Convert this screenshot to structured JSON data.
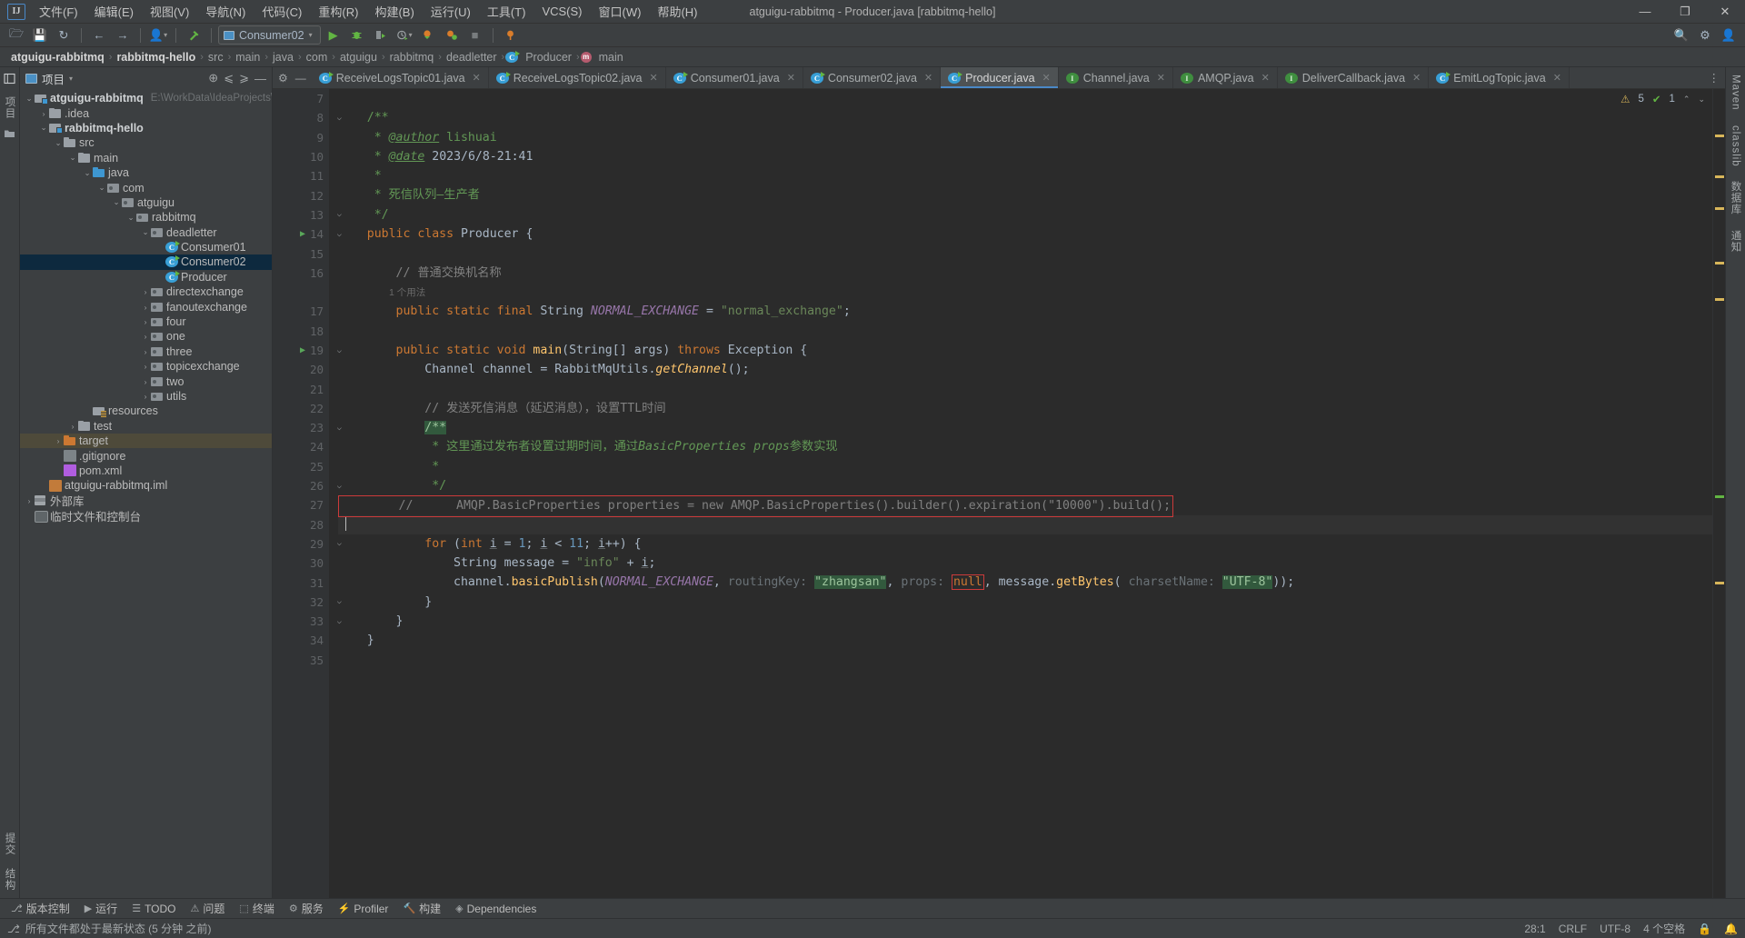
{
  "window": {
    "title": "atguigu-rabbitmq - Producer.java [rabbitmq-hello]",
    "logo": "IJ",
    "minimize": "—",
    "maximize": "❐",
    "close": "✕"
  },
  "menubar": {
    "items": [
      {
        "label": "文件(F)",
        "name": "menu-file"
      },
      {
        "label": "编辑(E)",
        "name": "menu-edit"
      },
      {
        "label": "视图(V)",
        "name": "menu-view"
      },
      {
        "label": "导航(N)",
        "name": "menu-navigate"
      },
      {
        "label": "代码(C)",
        "name": "menu-code"
      },
      {
        "label": "重构(R)",
        "name": "menu-refactor"
      },
      {
        "label": "构建(B)",
        "name": "menu-build"
      },
      {
        "label": "运行(U)",
        "name": "menu-run"
      },
      {
        "label": "工具(T)",
        "name": "menu-tools"
      },
      {
        "label": "VCS(S)",
        "name": "menu-vcs"
      },
      {
        "label": "窗口(W)",
        "name": "menu-window"
      },
      {
        "label": "帮助(H)",
        "name": "menu-help"
      }
    ]
  },
  "toolbar": {
    "open_icon": "🗁",
    "save_icon": "💾",
    "sync_icon": "↻",
    "back_icon": "←",
    "forward_icon": "→",
    "profile_icon": "👤",
    "build_icon": "🔨",
    "run_config": "Consumer02",
    "run_icon": "▶",
    "debug_icon": "🐞",
    "run_coverage_icon": "▷",
    "profiler_icon": "⏱",
    "stop_icon": "■",
    "search_icon": "🔍",
    "settings_icon": "⚙",
    "account_icon": "👤"
  },
  "breadcrumb": {
    "items": [
      {
        "label": "atguigu-rabbitmq",
        "bold": true
      },
      {
        "label": "rabbitmq-hello",
        "bold": true
      },
      {
        "label": "src",
        "bold": false
      },
      {
        "label": "main",
        "bold": false
      },
      {
        "label": "java",
        "bold": false
      },
      {
        "label": "com",
        "bold": false
      },
      {
        "label": "atguigu",
        "bold": false
      },
      {
        "label": "rabbitmq",
        "bold": false
      },
      {
        "label": "deadletter",
        "bold": false
      },
      {
        "label": "Producer",
        "bold": false,
        "icon": "class"
      },
      {
        "label": "main",
        "bold": false,
        "icon": "method"
      }
    ],
    "separator": "›"
  },
  "left_rail": {
    "structure_icon": "☰",
    "project_label": "项目",
    "bookmarks_icon": "🗀",
    "bottom": [
      {
        "label": "提交",
        "name": "rail-commit"
      },
      {
        "label": "结构",
        "name": "rail-structure"
      }
    ]
  },
  "project_panel": {
    "title": "项目",
    "dropdown_caret": "▾",
    "locate_icon": "⊕",
    "expand_icon": "⩽",
    "collapse_icon": "⩾",
    "hide_icon": "—",
    "tree": [
      {
        "depth": 0,
        "arrow": "⌄",
        "icon": "mod",
        "label": "atguigu-rabbitmq",
        "bold": true,
        "path": "E:\\WorkData\\IdeaProjects\\Ra",
        "name": "tree-item-atguigu-rabbitmq"
      },
      {
        "depth": 1,
        "arrow": "›",
        "icon": "folder",
        "label": ".idea",
        "name": "tree-item-idea"
      },
      {
        "depth": 1,
        "arrow": "⌄",
        "icon": "mod",
        "label": "rabbitmq-hello",
        "bold": true,
        "name": "tree-item-rabbitmq-hello"
      },
      {
        "depth": 2,
        "arrow": "⌄",
        "icon": "folder",
        "label": "src",
        "name": "tree-item-src"
      },
      {
        "depth": 3,
        "arrow": "⌄",
        "icon": "folder",
        "label": "main",
        "name": "tree-item-main"
      },
      {
        "depth": 4,
        "arrow": "⌄",
        "icon": "folder-blue",
        "label": "java",
        "name": "tree-item-java"
      },
      {
        "depth": 5,
        "arrow": "⌄",
        "icon": "pkg",
        "label": "com",
        "name": "tree-item-com"
      },
      {
        "depth": 6,
        "arrow": "⌄",
        "icon": "pkg",
        "label": "atguigu",
        "name": "tree-item-atguigu"
      },
      {
        "depth": 7,
        "arrow": "⌄",
        "icon": "pkg",
        "label": "rabbitmq",
        "name": "tree-item-rabbitmq"
      },
      {
        "depth": 8,
        "arrow": "⌄",
        "icon": "pkg",
        "label": "deadletter",
        "name": "tree-item-deadletter"
      },
      {
        "depth": 9,
        "arrow": "",
        "icon": "cls",
        "label": "Consumer01",
        "name": "tree-item-consumer01"
      },
      {
        "depth": 9,
        "arrow": "",
        "icon": "cls",
        "label": "Consumer02",
        "selected": true,
        "name": "tree-item-consumer02"
      },
      {
        "depth": 9,
        "arrow": "",
        "icon": "cls",
        "label": "Producer",
        "name": "tree-item-producer"
      },
      {
        "depth": 8,
        "arrow": "›",
        "icon": "pkg",
        "label": "directexchange",
        "name": "tree-item-directexchange"
      },
      {
        "depth": 8,
        "arrow": "›",
        "icon": "pkg",
        "label": "fanoutexchange",
        "name": "tree-item-fanoutexchange"
      },
      {
        "depth": 8,
        "arrow": "›",
        "icon": "pkg",
        "label": "four",
        "name": "tree-item-four"
      },
      {
        "depth": 8,
        "arrow": "›",
        "icon": "pkg",
        "label": "one",
        "name": "tree-item-one"
      },
      {
        "depth": 8,
        "arrow": "›",
        "icon": "pkg",
        "label": "three",
        "name": "tree-item-three"
      },
      {
        "depth": 8,
        "arrow": "›",
        "icon": "pkg",
        "label": "topicexchange",
        "name": "tree-item-topicexchange"
      },
      {
        "depth": 8,
        "arrow": "›",
        "icon": "pkg",
        "label": "two",
        "name": "tree-item-two"
      },
      {
        "depth": 8,
        "arrow": "›",
        "icon": "pkg",
        "label": "utils",
        "name": "tree-item-utils"
      },
      {
        "depth": 4,
        "arrow": "",
        "icon": "res",
        "label": "resources",
        "name": "tree-item-resources"
      },
      {
        "depth": 3,
        "arrow": "›",
        "icon": "folder",
        "label": "test",
        "name": "tree-item-test"
      },
      {
        "depth": 2,
        "arrow": "›",
        "icon": "folder-orange",
        "label": "target",
        "highlight": true,
        "name": "tree-item-target"
      },
      {
        "depth": 2,
        "arrow": "",
        "icon": "file-g",
        "label": ".gitignore",
        "name": "tree-item-gitignore"
      },
      {
        "depth": 2,
        "arrow": "",
        "icon": "file-m",
        "label": "pom.xml",
        "name": "tree-item-pom-xml"
      },
      {
        "depth": 1,
        "arrow": "",
        "icon": "file-iml",
        "label": "atguigu-rabbitmq.iml",
        "name": "tree-item-iml"
      },
      {
        "depth": 0,
        "arrow": "›",
        "icon": "lib",
        "label": "外部库",
        "name": "tree-item-external-libraries"
      },
      {
        "depth": 0,
        "arrow": "",
        "icon": "console",
        "label": "临时文件和控制台",
        "name": "tree-item-scratches"
      }
    ]
  },
  "tabs": {
    "settings_icon": "⚙",
    "hide_icon": "—",
    "overflow_icon": "⋮",
    "items": [
      {
        "label": "ReceiveLogsTopic01.java",
        "icon": "class",
        "active": false,
        "name": "tab-receivelogstopic01"
      },
      {
        "label": "ReceiveLogsTopic02.java",
        "icon": "class",
        "active": false,
        "name": "tab-receivelogstopic02"
      },
      {
        "label": "Consumer01.java",
        "icon": "class",
        "active": false,
        "name": "tab-consumer01"
      },
      {
        "label": "Consumer02.java",
        "icon": "class",
        "active": false,
        "name": "tab-consumer02"
      },
      {
        "label": "Producer.java",
        "icon": "class",
        "active": true,
        "name": "tab-producer"
      },
      {
        "label": "Channel.java",
        "icon": "interface",
        "active": false,
        "name": "tab-channel"
      },
      {
        "label": "AMQP.java",
        "icon": "interface",
        "active": false,
        "name": "tab-amqp"
      },
      {
        "label": "DeliverCallback.java",
        "icon": "interface",
        "active": false,
        "name": "tab-delivercallback"
      },
      {
        "label": "EmitLogTopic.java",
        "icon": "class",
        "active": false,
        "name": "tab-emitlogtopic"
      }
    ],
    "close_glyph": "✕"
  },
  "inspection": {
    "warning_icon": "⚠",
    "warning_count": "5",
    "ok_icon": "✔",
    "ok_count": "1",
    "up_icon": "⌃",
    "down_icon": "⌄"
  },
  "editor": {
    "first_line": 7,
    "lines": [
      {
        "n": 7,
        "html": ""
      },
      {
        "n": 8,
        "html": "    <span class='doc'>/**</span>",
        "fold": true
      },
      {
        "n": 9,
        "html": "     <span class='doc'>* </span><span class='doctag'>@author</span><span class='doc'> lishuai</span>"
      },
      {
        "n": 10,
        "html": "     <span class='doc'>* </span><span class='doctag'>@date</span><span class='doc'> </span><span class='docval'>2023/6/8-21:41</span>"
      },
      {
        "n": 11,
        "html": "     <span class='doc'>*</span>"
      },
      {
        "n": 12,
        "html": "     <span class='doc'>* 死信队列—生产者</span>"
      },
      {
        "n": 13,
        "html": "     <span class='doc'>*/</span>",
        "fold": true
      },
      {
        "n": 14,
        "html": "    <span class='kw'>public class </span><span class='typ'>Producer </span>{",
        "run": true,
        "fold": true
      },
      {
        "n": 15,
        "html": ""
      },
      {
        "n": 16,
        "html": "        <span class='cmt'>// 普通交换机名称</span>"
      },
      {
        "n": 16.5,
        "usage": "1 个用法"
      },
      {
        "n": 17,
        "html": "        <span class='kw'>public static final </span><span class='typ'>String </span><span class='cn'>NORMAL_EXCHANGE </span>= <span class='str'>\"normal_exchange\"</span>;"
      },
      {
        "n": 18,
        "html": ""
      },
      {
        "n": 19,
        "html": "        <span class='kw'>public static void </span><span class='fn'>main</span>(<span class='typ'>String</span>[] args) <span class='kw'>throws </span><span class='typ'>Exception </span>{",
        "run": true,
        "fold": true
      },
      {
        "n": 20,
        "html": "            <span class='typ'>Channel </span>channel = <span class='typ'>RabbitMqUtils</span>.<span class='fn' style='font-style:italic'>getChannel</span>();"
      },
      {
        "n": 21,
        "html": ""
      },
      {
        "n": 22,
        "html": "            <span class='cmt'>// 发送死信消息（延迟消息），设置TTL时间</span>"
      },
      {
        "n": 23,
        "html": "            <span class='strhl'>/**</span>",
        "fold": true
      },
      {
        "n": 24,
        "html": "             <span class='doc'>* 这里通过发布者设置过期时间，通过</span><span class='doc' style='font-style:italic'>BasicProperties props</span><span class='doc'>参数实现</span>"
      },
      {
        "n": 25,
        "html": "             <span class='doc'>*</span>"
      },
      {
        "n": 26,
        "html": "             <span class='doc'>*/</span>",
        "fold": true
      },
      {
        "n": 27,
        "html": "        <span class='cmt'>//      AMQP.BasicProperties properties = new AMQP.BasicProperties().builder().expiration(\"10000\").build();</span>",
        "errline": true
      },
      {
        "n": 28,
        "html": "",
        "current": true,
        "caret": true
      },
      {
        "n": 29,
        "html": "            <span class='kw'>for </span>(<span class='kw'>int </span><span class='lvar'>i</span> = <span class='num'>1</span>; <span class='lvar'>i</span> &lt; <span class='num'>11</span>; <span class='lvar'>i</span>++) {",
        "fold": true
      },
      {
        "n": 30,
        "html": "                <span class='typ'>String </span>message = <span class='str'>\"info\"</span> + <span class='lvar'>i</span>;"
      },
      {
        "n": 31,
        "html": "                channel.<span class='fn'>basicPublish</span>(<span class='cn'>NORMAL_EXCHANGE</span>, <span class='hint'>routingKey:</span> <span class='strhl'>\"zhangsan\"</span>, <span class='hint'>props:</span> <span class='errbox-inline'><span class='kw'>null</span></span>, message.<span class='fn'>getBytes</span>( <span class='hint'>charsetName:</span> <span class='strhl'>\"UTF-8\"</span>));"
      },
      {
        "n": 32,
        "html": "            }",
        "fold": true
      },
      {
        "n": 33,
        "html": "        }",
        "fold": true
      },
      {
        "n": 34,
        "html": "    }"
      },
      {
        "n": 35,
        "html": ""
      }
    ]
  },
  "tool_windows": {
    "items": [
      {
        "label": "版本控制",
        "icon": "⎇",
        "name": "toolwindow-version-control"
      },
      {
        "label": "运行",
        "icon": "▶",
        "name": "toolwindow-run"
      },
      {
        "label": "TODO",
        "icon": "☰",
        "name": "toolwindow-todo"
      },
      {
        "label": "问题",
        "icon": "⚠",
        "name": "toolwindow-problems"
      },
      {
        "label": "终端",
        "icon": "⬚",
        "name": "toolwindow-terminal"
      },
      {
        "label": "服务",
        "icon": "⚙",
        "name": "toolwindow-services"
      },
      {
        "label": "Profiler",
        "icon": "⚡",
        "name": "toolwindow-profiler"
      },
      {
        "label": "构建",
        "icon": "🔨",
        "name": "toolwindow-build"
      },
      {
        "label": "Dependencies",
        "icon": "◈",
        "name": "toolwindow-dependencies"
      }
    ]
  },
  "statusbar": {
    "left_icon": "⎇",
    "message": "所有文件都处于最新状态 (5 分钟 之前)",
    "caret_position": "28:1",
    "line_separator": "CRLF",
    "encoding": "UTF-8",
    "indent": "4 个空格",
    "lock_icon": "🔒",
    "notify_icon": "🔔"
  },
  "right_rail": {
    "items": [
      {
        "label": "Maven",
        "name": "rail-maven"
      },
      {
        "label": "classlib",
        "name": "rail-classlib"
      },
      {
        "label": "数据库",
        "name": "rail-database"
      },
      {
        "label": "通知",
        "name": "rail-notifications"
      }
    ]
  },
  "colors": {
    "accent": "#4a88c7",
    "panel": "#3c3f41",
    "editor_bg": "#2b2b2b",
    "gutter_bg": "#313335",
    "selection": "#0d293e",
    "error": "#cc3a3a",
    "string": "#6a8759",
    "keyword": "#cc7832"
  }
}
